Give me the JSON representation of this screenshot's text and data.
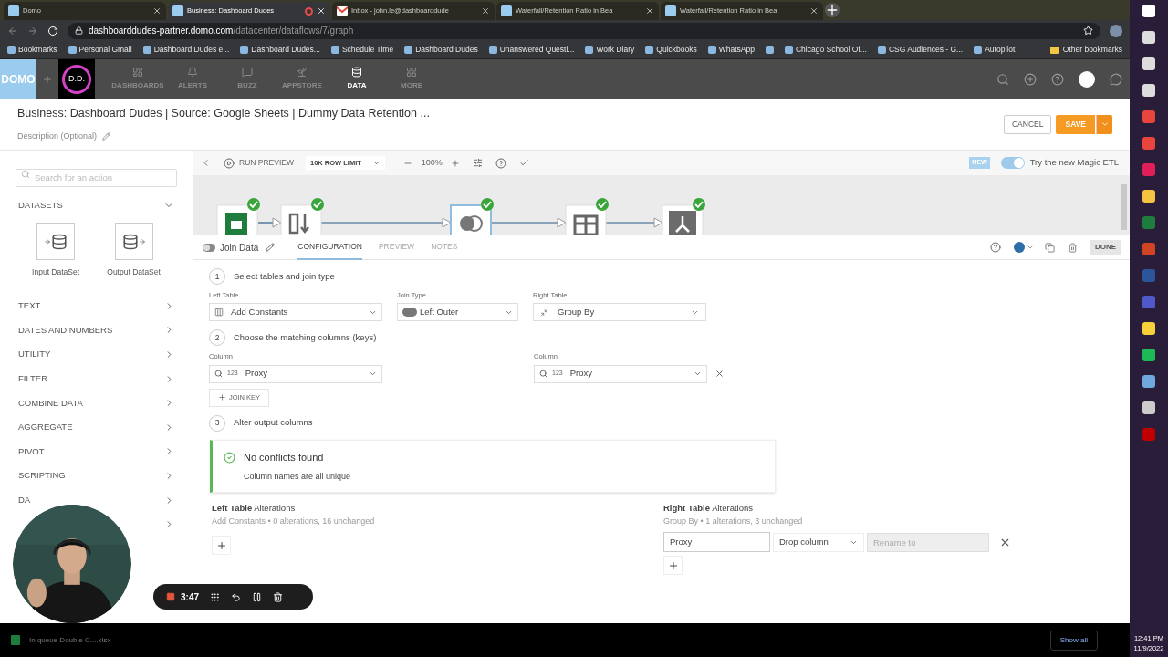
{
  "browser": {
    "tabs": [
      {
        "kind": "domo",
        "title": "Domo",
        "selected": false,
        "recording": false
      },
      {
        "kind": "domo",
        "title": "Business: Dashboard Dudes",
        "selected": true,
        "recording": true
      },
      {
        "kind": "gmail",
        "title": "Inbox - john.le@dashboarddude",
        "selected": false,
        "recording": false
      },
      {
        "kind": "domo",
        "title": "Waterfall/Retention Ratio in Bea",
        "selected": false,
        "recording": false
      },
      {
        "kind": "domo",
        "title": "Waterfall/Retention Ratio in Bea",
        "selected": false,
        "recording": false
      }
    ],
    "url_host": "dashboarddudes-partner.domo.com",
    "url_path": "/datacenter/dataflows/7/graph",
    "bookmarks": [
      {
        "kind": "link",
        "label": "Bookmarks"
      },
      {
        "kind": "link",
        "label": "Personal Gmail"
      },
      {
        "kind": "link",
        "label": "Dashboard Dudes e..."
      },
      {
        "kind": "link",
        "label": "Dashboard Dudes..."
      },
      {
        "kind": "link",
        "label": "Schedule Time"
      },
      {
        "kind": "link",
        "label": "Dashboard Dudes"
      },
      {
        "kind": "link",
        "label": "Unanswered Questi..."
      },
      {
        "kind": "link",
        "label": "Work Diary"
      },
      {
        "kind": "link",
        "label": "Quickbooks"
      },
      {
        "kind": "link",
        "label": "WhatsApp"
      },
      {
        "kind": "icon_only"
      },
      {
        "kind": "link",
        "label": "Chicago School Of..."
      },
      {
        "kind": "link",
        "label": "CSG Audiences - G..."
      },
      {
        "kind": "link",
        "label": "Autopilot"
      }
    ],
    "other_bookmarks": "Other bookmarks"
  },
  "app": {
    "logo": "DOMO",
    "badge": "D.D.",
    "nav": [
      {
        "label": "DASHBOARDS",
        "selected": false
      },
      {
        "label": "ALERTS",
        "selected": false
      },
      {
        "label": "BUZZ",
        "selected": false
      },
      {
        "label": "APPSTORE",
        "selected": false
      },
      {
        "label": "DATA",
        "selected": true
      },
      {
        "label": "MORE",
        "selected": false
      }
    ]
  },
  "header": {
    "title": "Business: Dashboard Dudes | Source: Google Sheets | Dummy Data Retention ...",
    "description": "Description (Optional)",
    "cancel": "CANCEL",
    "save": "SAVE"
  },
  "sidebar": {
    "search": {
      "placeholder": "Search for an action"
    },
    "datasets_title": "DATASETS",
    "datasets": [
      {
        "label": "Input DataSet",
        "kind": "input"
      },
      {
        "label": "Output DataSet",
        "kind": "output"
      }
    ],
    "items": [
      {
        "kind": "category",
        "label": "TEXT"
      },
      {
        "kind": "category",
        "label": "DATES AND NUMBERS"
      },
      {
        "kind": "category",
        "label": "UTILITY"
      },
      {
        "kind": "category",
        "label": "FILTER"
      },
      {
        "kind": "category",
        "label": "COMBINE DATA"
      },
      {
        "kind": "category",
        "label": "AGGREGATE"
      },
      {
        "kind": "category",
        "label": "PIVOT"
      },
      {
        "kind": "category",
        "label": "SCRIPTING"
      },
      {
        "kind": "category",
        "label": "DA"
      },
      {
        "kind": "hidden_label"
      }
    ]
  },
  "toolbar": {
    "run_preview": "RUN PREVIEW",
    "row_limit": "10K ROW LIMIT",
    "zoom": "100%",
    "new_badge": "NEW",
    "magic_etl": {
      "label": "Try the new Magic ETL",
      "on": true
    }
  },
  "canvas": {
    "nodes": [
      {
        "kind": "sheets",
        "selected": false,
        "valid": true
      },
      {
        "kind": "constants",
        "selected": false,
        "valid": true
      },
      {
        "kind": "join",
        "selected": true,
        "valid": true
      },
      {
        "kind": "table",
        "selected": false,
        "valid": true
      },
      {
        "kind": "split",
        "selected": false,
        "valid": true
      }
    ]
  },
  "panel": {
    "name": "Join Data",
    "enabled": false,
    "tabs": [
      {
        "label": "CONFIGURATION",
        "selected": true
      },
      {
        "label": "PREVIEW",
        "selected": false
      },
      {
        "label": "NOTES",
        "selected": false
      }
    ],
    "done": "DONE"
  },
  "config": {
    "step1": {
      "number": "1",
      "title": "Select tables and join type",
      "left_label": "Left Table",
      "left_value": "Add Constants",
      "join_label": "Join Type",
      "join_value": "Left Outer",
      "right_label": "Right Table",
      "right_value": "Group By"
    },
    "step2": {
      "number": "2",
      "title": "Choose the matching columns (keys)",
      "left_label": "Column",
      "left_type": "123",
      "left_value": "Proxy",
      "right_label": "Column",
      "right_type": "123",
      "right_value": "Proxy",
      "join_key": "JOIN KEY"
    },
    "step3": {
      "number": "3",
      "title": "Alter output columns"
    },
    "alert": {
      "title": "No conflicts found",
      "message": "Column names are all unique"
    },
    "left_alterations": {
      "title": "**Left Table** Alterations",
      "summary": "Add Constants • 0 alterations, 16 unchanged"
    },
    "right_alterations": {
      "title": "**Right Table** Alterations",
      "summary": "Group By • 1 alterations, 3 unchanged",
      "rows": [
        {
          "column": "Proxy",
          "action": "Drop column",
          "rename": {
            "placeholder": "Rename to",
            "disabled": true
          }
        }
      ]
    }
  },
  "recorder": {
    "time": "3:47"
  },
  "downloads": {
    "file": "In queue Double C....xlsx",
    "show_all": "Show all"
  },
  "clock": {
    "time": "12:41 PM",
    "date": "11/9/2022"
  }
}
